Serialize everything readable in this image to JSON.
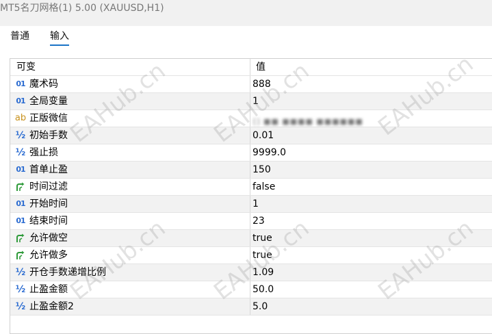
{
  "window": {
    "title": "MT5名刀网格(1) 5.00 (XAUUSD,H1)"
  },
  "tabs": [
    {
      "label": "普通",
      "active": false
    },
    {
      "label": "输入",
      "active": true
    }
  ],
  "table": {
    "columns": [
      "可变",
      "值"
    ],
    "rows": [
      {
        "type": "int",
        "icon": "int-type-icon",
        "name": "魔术码",
        "value": "888"
      },
      {
        "type": "int",
        "icon": "int-type-icon",
        "name": "全局变量",
        "value": "1"
      },
      {
        "type": "str",
        "icon": "string-type-icon",
        "name": "正版微信",
        "value": "[] ■■ ■■■■ ■■■■■■"
      },
      {
        "type": "dbl",
        "icon": "double-type-icon",
        "name": "初始手数",
        "value": "0.01"
      },
      {
        "type": "dbl",
        "icon": "double-type-icon",
        "name": "强止损",
        "value": "9999.0"
      },
      {
        "type": "int",
        "icon": "int-type-icon",
        "name": "首单止盈",
        "value": "150"
      },
      {
        "type": "bool",
        "icon": "bool-type-icon",
        "name": "时间过滤",
        "value": "false"
      },
      {
        "type": "int",
        "icon": "int-type-icon",
        "name": "开始时间",
        "value": "1"
      },
      {
        "type": "int",
        "icon": "int-type-icon",
        "name": "结束时间",
        "value": "23"
      },
      {
        "type": "bool",
        "icon": "bool-type-icon",
        "name": "允许做空",
        "value": "true"
      },
      {
        "type": "bool",
        "icon": "bool-type-icon",
        "name": "允许做多",
        "value": "true"
      },
      {
        "type": "dbl",
        "icon": "double-type-icon",
        "name": "开仓手数递增比例",
        "value": "1.09"
      },
      {
        "type": "dbl",
        "icon": "double-type-icon",
        "name": "止盈金额",
        "value": "50.0"
      },
      {
        "type": "dbl",
        "icon": "double-type-icon",
        "name": "止盈金额2",
        "value": "5.0"
      }
    ]
  },
  "icon_glyphs": {
    "int": "01",
    "str": "ab",
    "dbl": "½"
  },
  "watermark": {
    "text": "EAHub.cn"
  },
  "colors": {
    "accent": "#1a73c6",
    "int_icon": "#2a6bd1",
    "string_icon": "#c8911c",
    "bool_icon": "#2e9a3a",
    "alt_row": "#f2f2f2"
  }
}
